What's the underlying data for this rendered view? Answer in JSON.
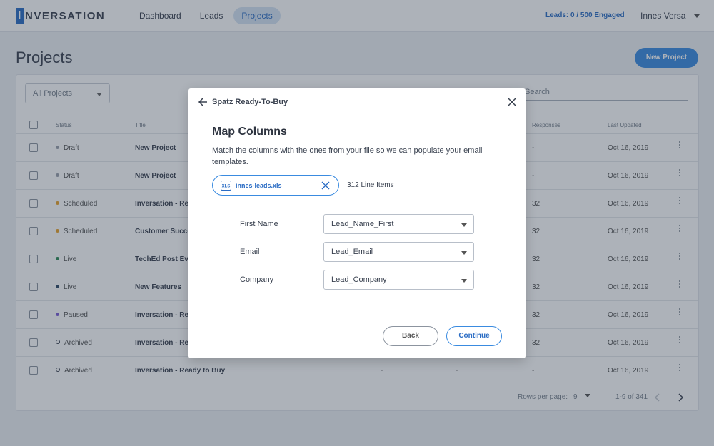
{
  "app": {
    "logo_letter": "I",
    "logo_rest": "NVERSATION"
  },
  "nav": {
    "tabs": [
      {
        "label": "Dashboard",
        "active": false
      },
      {
        "label": "Leads",
        "active": false
      },
      {
        "label": "Projects",
        "active": true
      }
    ],
    "engaged": "Leads: 0 / 500 Engaged",
    "user_name": "Innes Versa"
  },
  "page": {
    "title": "Projects",
    "new_project_label": "New Project"
  },
  "table": {
    "filter_value": "All Projects",
    "search_placeholder": "Search",
    "headers": {
      "status": "Status",
      "title": "Title",
      "responses": "Responses",
      "last_updated": "Last Updated"
    },
    "rows": [
      {
        "status": "Draft",
        "status_color": "#9aa1ab",
        "title": "New Project",
        "col3": "",
        "col4": "",
        "responses": "-",
        "updated": "Oct 16, 2019"
      },
      {
        "status": "Draft",
        "status_color": "#9aa1ab",
        "title": "New Project",
        "col3": "",
        "col4": "",
        "responses": "-",
        "updated": "Oct 16, 2019"
      },
      {
        "status": "Scheduled",
        "status_color": "#e8a22b",
        "title": "Inversation - Rea",
        "col3": "",
        "col4": "",
        "responses": "32",
        "updated": "Oct 16, 2019"
      },
      {
        "status": "Scheduled",
        "status_color": "#e8a22b",
        "title": "Customer Succe",
        "col3": "",
        "col4": "",
        "responses": "32",
        "updated": "Oct 16, 2019"
      },
      {
        "status": "Live",
        "status_color": "#2e8b57",
        "title": "TechEd Post Eve",
        "col3": "",
        "col4": "",
        "responses": "32",
        "updated": "Oct 16, 2019"
      },
      {
        "status": "Live",
        "status_color": "#2e4a66",
        "title": "New Features",
        "col3": "",
        "col4": "",
        "responses": "32",
        "updated": "Oct 16, 2019"
      },
      {
        "status": "Paused",
        "status_color": "#7b5ed6",
        "title": "Inversation - Rea",
        "col3": "",
        "col4": "",
        "responses": "32",
        "updated": "Oct 16, 2019"
      },
      {
        "status": "Archived",
        "status_color": "ring",
        "title": "Inversation - Rea",
        "col3": "",
        "col4": "",
        "responses": "32",
        "updated": "Oct 16, 2019"
      },
      {
        "status": "Archived",
        "status_color": "ring",
        "title": "Inversation - Ready to Buy",
        "col3": "-",
        "col4": "-",
        "responses": "-",
        "updated": "Oct 16, 2019"
      }
    ],
    "footer": {
      "rows_per_page_label": "Rows per page:",
      "rows_per_page_value": "9",
      "range": "1-9 of 341"
    }
  },
  "modal": {
    "header_title": "Spatz Ready-To-Buy",
    "heading": "Map Columns",
    "description": "Match the columns with the ones from your file so we can populate your email templates.",
    "file_icon_text": "XLS",
    "file_name": "innes-leads.xls",
    "line_items": "312 Line Items",
    "mappings": [
      {
        "label": "First Name",
        "value": "Lead_Name_First"
      },
      {
        "label": "Email",
        "value": "Lead_Email"
      },
      {
        "label": "Company",
        "value": "Lead_Company"
      }
    ],
    "back_label": "Back",
    "continue_label": "Continue"
  },
  "colors": {
    "accent": "#2a6cc4",
    "button_blue": "#3a8be0"
  }
}
